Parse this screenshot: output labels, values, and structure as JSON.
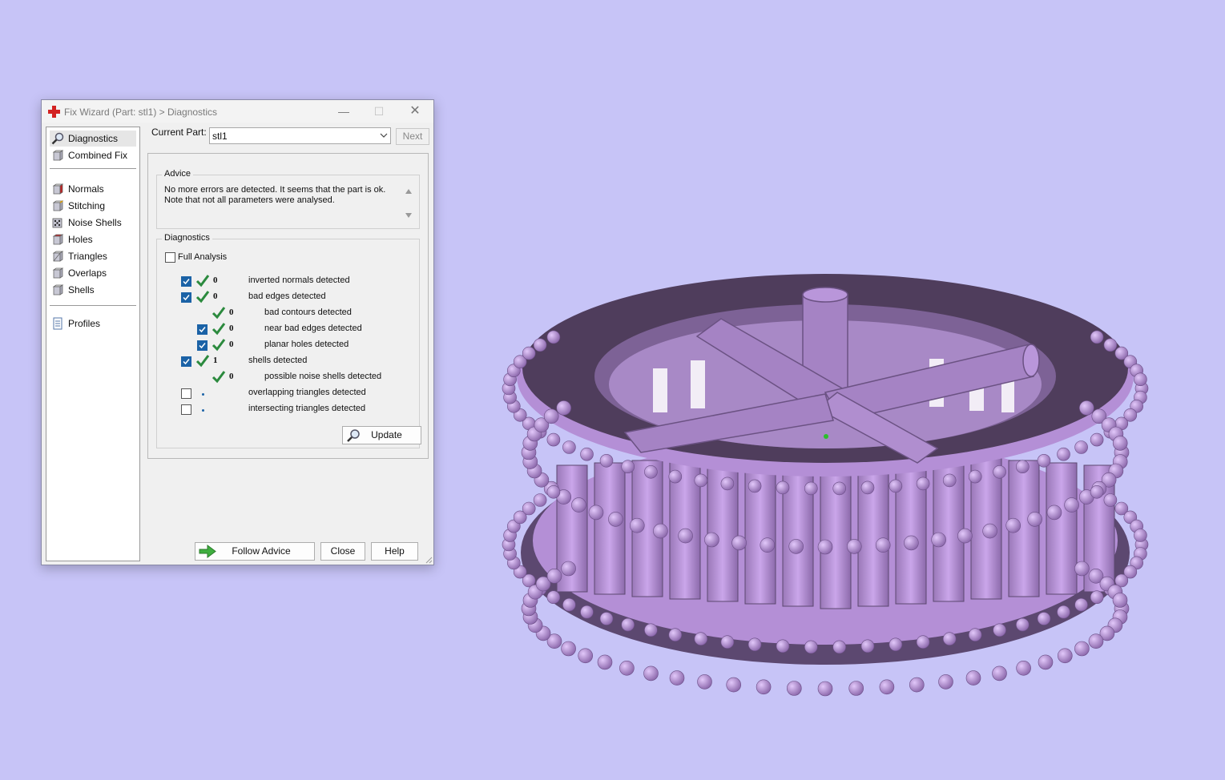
{
  "window": {
    "title": "Fix Wizard (Part: stl1) > Diagnostics"
  },
  "nav": {
    "items": [
      {
        "label": "Diagnostics",
        "icon": "magnifier-icon"
      },
      {
        "label": "Combined Fix",
        "icon": "cube-icon"
      },
      {
        "label": "Normals",
        "icon": "cube-red-face-icon"
      },
      {
        "label": "Stitching",
        "icon": "cube-stitch-icon"
      },
      {
        "label": "Noise Shells",
        "icon": "dice-icon"
      },
      {
        "label": "Holes",
        "icon": "cube-red-face-icon"
      },
      {
        "label": "Triangles",
        "icon": "triangles-cube-icon"
      },
      {
        "label": "Overlaps",
        "icon": "cube-icon"
      },
      {
        "label": "Shells",
        "icon": "cube-icon"
      },
      {
        "label": "Profiles",
        "icon": "document-icon"
      }
    ],
    "selected": "Diagnostics"
  },
  "current_part": {
    "label": "Current Part:",
    "value": "stl1",
    "next_label": "Next"
  },
  "advice": {
    "title": "Advice",
    "line1": "No more errors are detected. It seems that the part is ok.",
    "line2": "Note that not all parameters were analysed."
  },
  "diagnostics": {
    "title": "Diagnostics",
    "full_analysis_label": "Full Analysis",
    "full_analysis_checked": false,
    "rows": [
      {
        "checked": true,
        "status": "ok",
        "count": "0",
        "label": "inverted normals detected",
        "indent": 0
      },
      {
        "checked": true,
        "status": "ok",
        "count": "0",
        "label": "bad edges detected",
        "indent": 0
      },
      {
        "checked": null,
        "status": "ok",
        "count": "0",
        "label": "bad contours detected",
        "indent": 1
      },
      {
        "checked": true,
        "status": "ok",
        "count": "0",
        "label": "near bad edges detected",
        "indent": 1
      },
      {
        "checked": true,
        "status": "ok",
        "count": "0",
        "label": "planar holes detected",
        "indent": 1
      },
      {
        "checked": true,
        "status": "ok",
        "count": "1",
        "label": "shells detected",
        "indent": 0
      },
      {
        "checked": null,
        "status": "ok",
        "count": "0",
        "label": "possible noise shells detected",
        "indent": 1
      },
      {
        "checked": false,
        "status": "pending",
        "count": "",
        "label": "overlapping triangles detected",
        "indent": 0
      },
      {
        "checked": false,
        "status": "pending",
        "count": "",
        "label": "intersecting triangles detected",
        "indent": 0
      }
    ],
    "update_label": "Update"
  },
  "footer": {
    "follow_advice_label": "Follow Advice",
    "close_label": "Close",
    "help_label": "Help"
  },
  "colors": {
    "background": "#c7c4f7",
    "model": "#b48fd6",
    "model_dark": "#4f3d5c",
    "checkbox": "#1b62a6",
    "tick": "#2b8a3e"
  }
}
